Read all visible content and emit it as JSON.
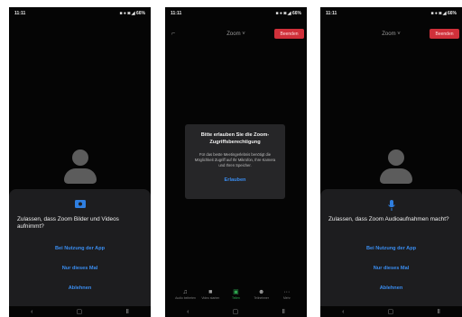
{
  "status_bar": {
    "time": "11:11",
    "right": "■ ● ◙ ◢ 66%"
  },
  "phone1": {
    "dialog_message": "Zulassen, dass Zoom Bilder und Videos aufnimmt?",
    "options": [
      "Bei Nutzung der App",
      "Nur dieses Mal",
      "Ablehnen"
    ]
  },
  "phone2": {
    "back_icon": "minimize-icon",
    "meeting_title": "Zoom ˅",
    "end_label": "Beenden",
    "dialog_title": "Bitte erlauben Sie die Zoom-Zugriffsberechtigung",
    "dialog_body": "Für das beste Meetingerlebnis benötigt die Möglichkeit Zugriff auf Ihr Mikrofon, Ihre Kamera und Ihren Speicher.",
    "dialog_button": "Erlauben",
    "toolbar": [
      {
        "label": "Audio beitreten",
        "icon": "audio-icon"
      },
      {
        "label": "Video starten",
        "icon": "video-icon"
      },
      {
        "label": "Teilen",
        "icon": "share-icon"
      },
      {
        "label": "Teilnehmer",
        "icon": "participants-icon"
      },
      {
        "label": "Mehr",
        "icon": "more-icon"
      }
    ]
  },
  "phone3": {
    "meeting_title": "Zoom ˅",
    "end_label": "Beenden",
    "dialog_message": "Zulassen, dass Zoom Audioaufnahmen macht?",
    "options": [
      "Bei Nutzung der App",
      "Nur dieses Mal",
      "Ablehnen"
    ]
  },
  "navbar": {
    "back": "‹",
    "home": "▢",
    "recents": "Ⅱ"
  },
  "colors": {
    "accent_blue": "#3a8df0",
    "end_red": "#d0303a",
    "share_green": "#2ea84f",
    "background": "#050505"
  }
}
